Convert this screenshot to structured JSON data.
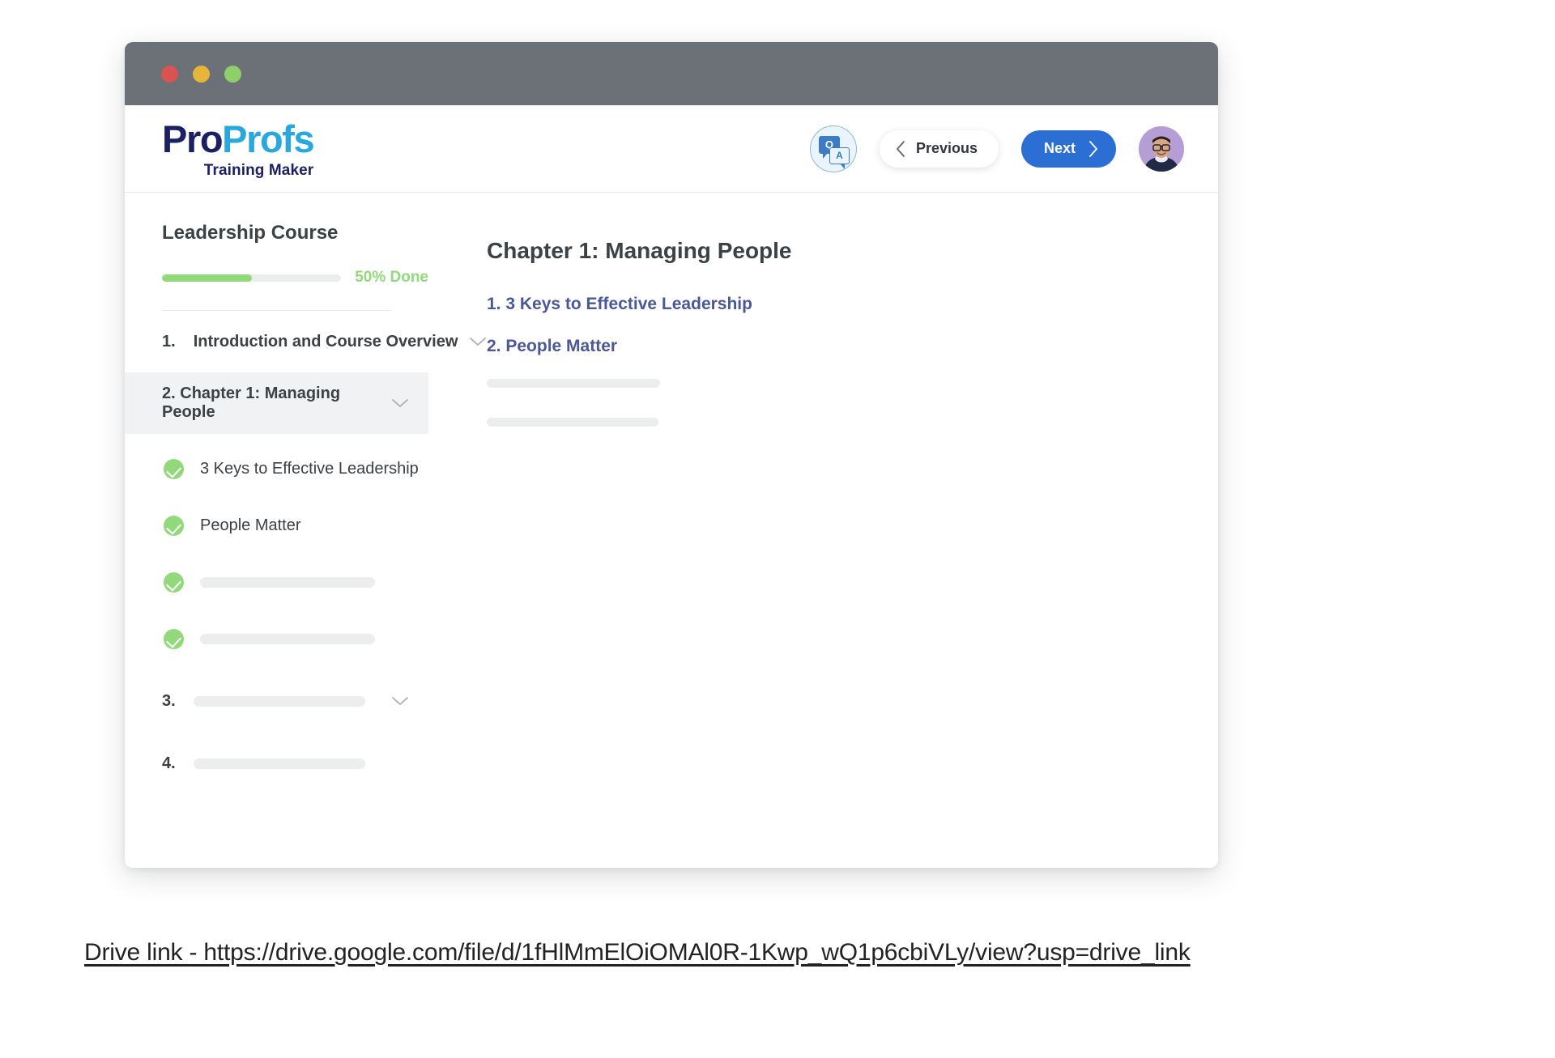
{
  "window": {
    "traffic_lights": [
      "close",
      "minimize",
      "maximize"
    ]
  },
  "header": {
    "logo": {
      "part1": "Pro",
      "part2": "Profs",
      "subtitle": "Training Maker"
    },
    "qa_icon": {
      "q": "Q",
      "a": "A"
    },
    "previous_label": "Previous",
    "next_label": "Next"
  },
  "sidebar": {
    "course_title": "Leadership Course",
    "progress": {
      "percent": 50,
      "label": "50% Done"
    },
    "items": [
      {
        "num": "1.",
        "label": "Introduction and Course Overview",
        "redacted": false,
        "expandable": true,
        "active": false
      },
      {
        "num": "2.",
        "label": "Chapter 1: Managing People",
        "redacted": false,
        "expandable": true,
        "active": true
      },
      {
        "num": "3.",
        "label": "",
        "redacted": true,
        "expandable": true,
        "active": false
      },
      {
        "num": "4.",
        "label": "",
        "redacted": true,
        "expandable": false,
        "active": false
      }
    ],
    "sublessons": [
      {
        "label": "3 Keys to Effective Leadership",
        "completed": true,
        "redacted": false
      },
      {
        "label": "People Matter",
        "completed": true,
        "redacted": false
      },
      {
        "label": "",
        "completed": true,
        "redacted": true
      },
      {
        "label": "",
        "completed": true,
        "redacted": true
      }
    ]
  },
  "main": {
    "title": "Chapter 1: Managing People",
    "links": [
      {
        "label": "1. 3 Keys to Effective Leadership"
      },
      {
        "label": "2. People Matter"
      }
    ],
    "redacted_lines": 2
  },
  "caption": {
    "text": "Drive link  - https://drive.google.com/file/d/1fHlMmElOiOMAl0R-1Kwp_wQ1p6cbiVLy/view?usp=drive_link"
  },
  "colors": {
    "accent_blue": "#2b6fd4",
    "logo_navy": "#1b1f63",
    "logo_cyan": "#29a8e0",
    "progress_green": "#91d97b",
    "link_indigo": "#4a5897",
    "titlebar_gray": "#6b7176"
  }
}
